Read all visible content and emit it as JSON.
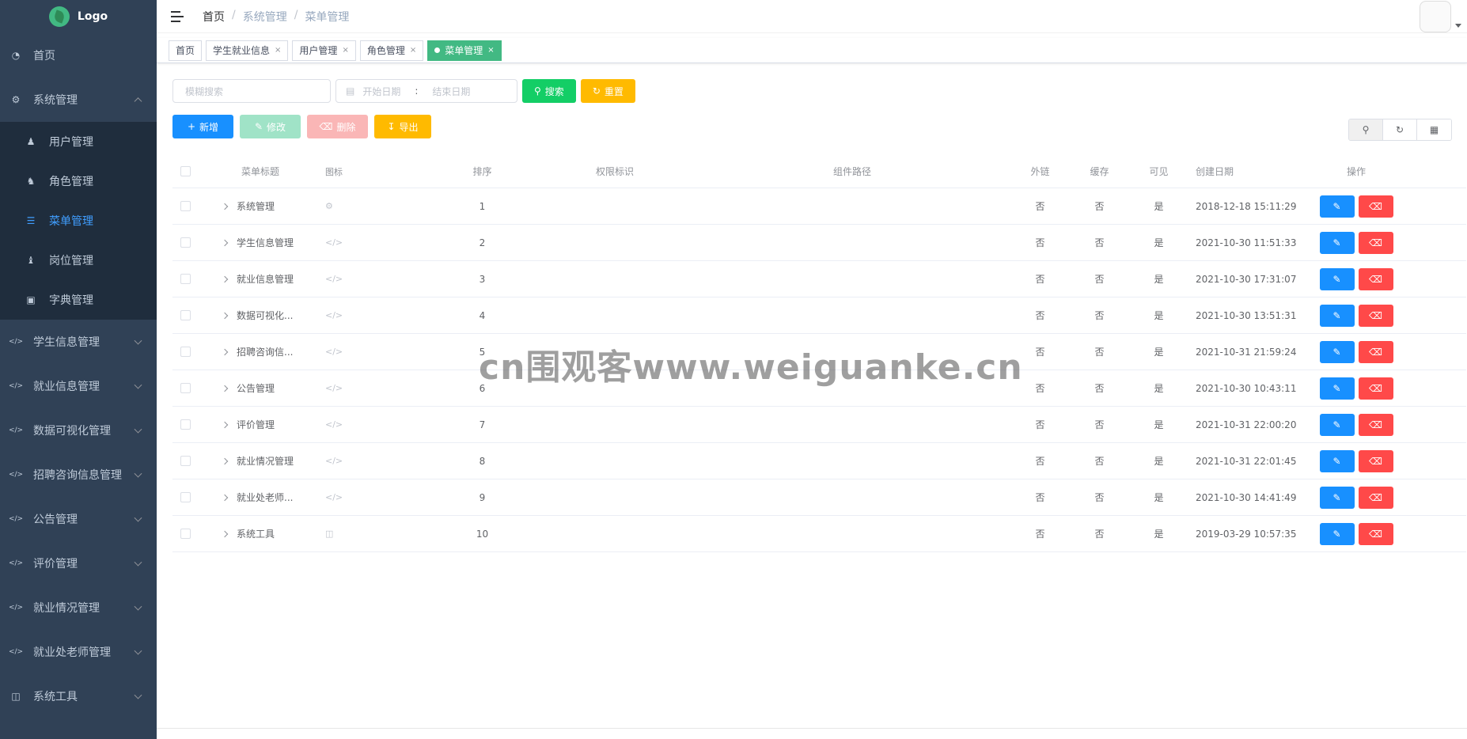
{
  "logo": {
    "text": "Logo"
  },
  "sidebar": {
    "items": [
      {
        "label": "首页",
        "icon": "dashboard-icon"
      },
      {
        "label": "系统管理",
        "icon": "gear-icon",
        "expanded": true,
        "children": [
          {
            "label": "用户管理",
            "icon": "users-icon"
          },
          {
            "label": "角色管理",
            "icon": "role-icon"
          },
          {
            "label": "菜单管理",
            "icon": "list-icon",
            "active": true
          },
          {
            "label": "岗位管理",
            "icon": "post-icon"
          },
          {
            "label": "字典管理",
            "icon": "dict-icon"
          }
        ]
      },
      {
        "label": "学生信息管理",
        "icon": "code-icon"
      },
      {
        "label": "就业信息管理",
        "icon": "code-icon"
      },
      {
        "label": "数据可视化管理",
        "icon": "code-icon"
      },
      {
        "label": "招聘咨询信息管理",
        "icon": "code-icon"
      },
      {
        "label": "公告管理",
        "icon": "code-icon"
      },
      {
        "label": "评价管理",
        "icon": "code-icon"
      },
      {
        "label": "就业情况管理",
        "icon": "code-icon"
      },
      {
        "label": "就业处老师管理",
        "icon": "code-icon"
      },
      {
        "label": "系统工具",
        "icon": "toolbox-icon"
      }
    ]
  },
  "breadcrumb": {
    "home": "首页",
    "sep": "/",
    "level1": "系统管理",
    "level2": "菜单管理"
  },
  "tags": [
    {
      "label": "首页",
      "closable": false
    },
    {
      "label": "学生就业信息",
      "closable": true
    },
    {
      "label": "用户管理",
      "closable": true
    },
    {
      "label": "角色管理",
      "closable": true
    },
    {
      "label": "菜单管理",
      "closable": true,
      "active": true
    }
  ],
  "tag_close": "×",
  "filters": {
    "search_placeholder": "模糊搜索",
    "date_start_placeholder": "开始日期",
    "date_sep": ":",
    "date_end_placeholder": "结束日期",
    "search_button": "搜索",
    "reset_button": "重置"
  },
  "actions": {
    "add": "新增",
    "edit": "修改",
    "delete": "删除",
    "export": "导出"
  },
  "table": {
    "headers": {
      "title": "菜单标题",
      "icon": "图标",
      "sort": "排序",
      "permission": "权限标识",
      "path": "组件路径",
      "external": "外链",
      "cache": "缓存",
      "visible": "可见",
      "created": "创建日期",
      "ops": "操作"
    },
    "rows": [
      {
        "title": "系统管理",
        "icon": "gear-icon",
        "sort": "1",
        "permission": "",
        "path": "",
        "external": "否",
        "cache": "否",
        "visible": "是",
        "created": "2018-12-18 15:11:29"
      },
      {
        "title": "学生信息管理",
        "icon": "code-icon",
        "sort": "2",
        "permission": "",
        "path": "",
        "external": "否",
        "cache": "否",
        "visible": "是",
        "created": "2021-10-30 11:51:33"
      },
      {
        "title": "就业信息管理",
        "icon": "code-icon",
        "sort": "3",
        "permission": "",
        "path": "",
        "external": "否",
        "cache": "否",
        "visible": "是",
        "created": "2021-10-30 17:31:07"
      },
      {
        "title": "数据可视化...",
        "icon": "code-icon",
        "sort": "4",
        "permission": "",
        "path": "",
        "external": "否",
        "cache": "否",
        "visible": "是",
        "created": "2021-10-30 13:51:31"
      },
      {
        "title": "招聘咨询信...",
        "icon": "code-icon",
        "sort": "5",
        "permission": "",
        "path": "",
        "external": "否",
        "cache": "否",
        "visible": "是",
        "created": "2021-10-31 21:59:24"
      },
      {
        "title": "公告管理",
        "icon": "code-icon",
        "sort": "6",
        "permission": "",
        "path": "",
        "external": "否",
        "cache": "否",
        "visible": "是",
        "created": "2021-10-30 10:43:11"
      },
      {
        "title": "评价管理",
        "icon": "code-icon",
        "sort": "7",
        "permission": "",
        "path": "",
        "external": "否",
        "cache": "否",
        "visible": "是",
        "created": "2021-10-31 22:00:20"
      },
      {
        "title": "就业情况管理",
        "icon": "code-icon",
        "sort": "8",
        "permission": "",
        "path": "",
        "external": "否",
        "cache": "否",
        "visible": "是",
        "created": "2021-10-31 22:01:45"
      },
      {
        "title": "就业处老师...",
        "icon": "code-icon",
        "sort": "9",
        "permission": "",
        "path": "",
        "external": "否",
        "cache": "否",
        "visible": "是",
        "created": "2021-10-30 14:41:49"
      },
      {
        "title": "系统工具",
        "icon": "toolbox-icon",
        "sort": "10",
        "permission": "",
        "path": "",
        "external": "否",
        "cache": "否",
        "visible": "是",
        "created": "2019-03-29 10:57:35"
      }
    ]
  },
  "watermark": "cn围观客www.weiguanke.cn",
  "colors": {
    "sidebar_bg": "#304156",
    "submenu_bg": "#1f2d3d",
    "active": "#409eff",
    "primary": "#1890ff",
    "success": "#13ce66",
    "warning": "#ffba00",
    "danger": "#ff4949",
    "tag_active": "#42b983"
  }
}
